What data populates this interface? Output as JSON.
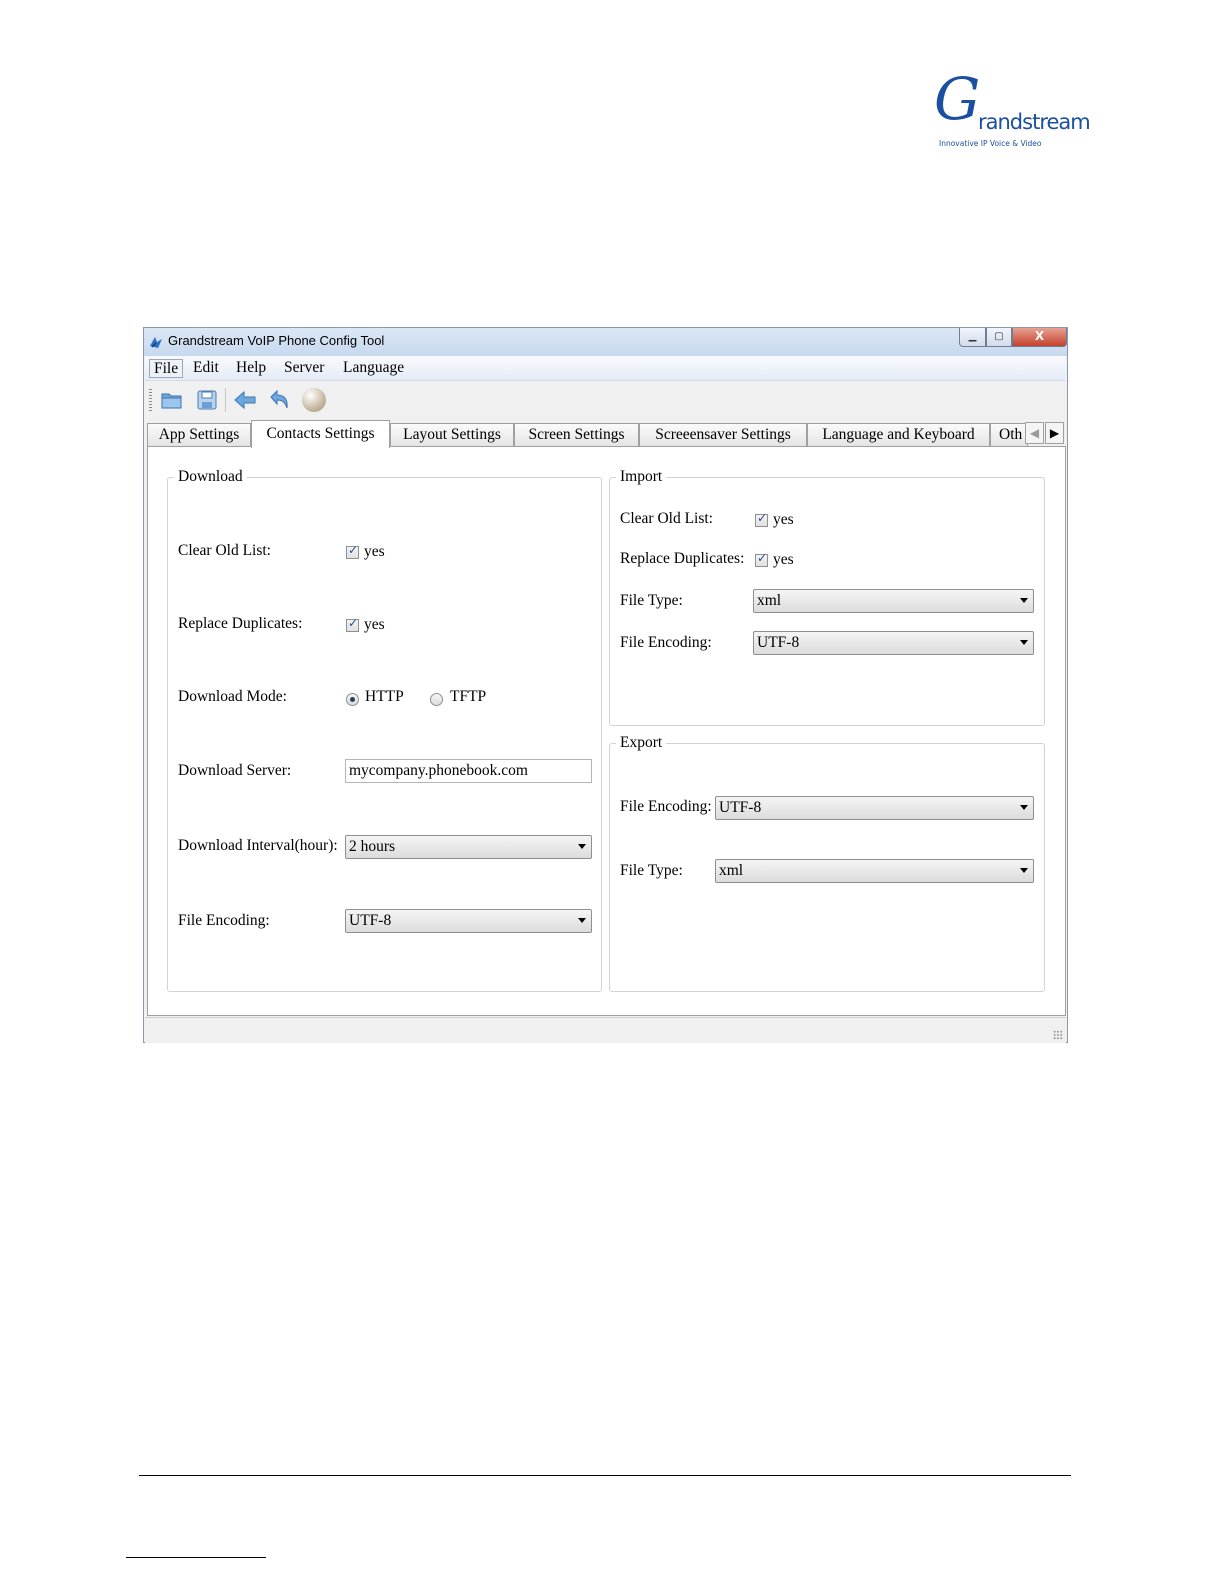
{
  "logo": {
    "initial": "G",
    "brand": "randstream",
    "tagline": "Innovative IP Voice & Video"
  },
  "window": {
    "title": "Grandstream VoIP Phone Config Tool",
    "controls": {
      "minimize": "▁",
      "maximize": "▢",
      "close": "X"
    }
  },
  "menu": [
    "File",
    "Edit",
    "Help",
    "Server",
    "Language"
  ],
  "toolbar": {
    "icons": [
      "open-folder-icon",
      "save-icon",
      "back-arrow-icon",
      "undo-icon",
      "sphere-icon"
    ]
  },
  "tabs": [
    "App Settings",
    "Contacts Settings",
    "Layout Settings",
    "Screen Settings",
    "Screeensaver Settings",
    "Language and Keyboard",
    "Oth"
  ],
  "active_tab": "Contacts Settings",
  "download": {
    "legend": "Download",
    "clear_old_list_label": "Clear Old List:",
    "clear_old_list_value": "yes",
    "replace_duplicates_label": "Replace Duplicates:",
    "replace_duplicates_value": "yes",
    "mode_label": "Download Mode:",
    "mode_http": "HTTP",
    "mode_tftp": "TFTP",
    "mode_selected": "HTTP",
    "server_label": "Download Server:",
    "server_value": "mycompany.phonebook.com",
    "interval_label": "Download Interval(hour):",
    "interval_value": "2 hours",
    "encoding_label": "File Encoding:",
    "encoding_value": "UTF-8"
  },
  "import": {
    "legend": "Import",
    "clear_old_list_label": "Clear Old List:",
    "clear_old_list_value": "yes",
    "replace_duplicates_label": "Replace Duplicates:",
    "replace_duplicates_value": "yes",
    "file_type_label": "File Type:",
    "file_type_value": "xml",
    "encoding_label": "File Encoding:",
    "encoding_value": "UTF-8"
  },
  "export": {
    "legend": "Export",
    "encoding_label": "File Encoding:",
    "encoding_value": "UTF-8",
    "file_type_label": "File Type:",
    "file_type_value": "xml"
  },
  "colors": {
    "brand": "#1c4fa0",
    "title_bar": "#c7d9ee",
    "close_button": "#c4402b"
  }
}
